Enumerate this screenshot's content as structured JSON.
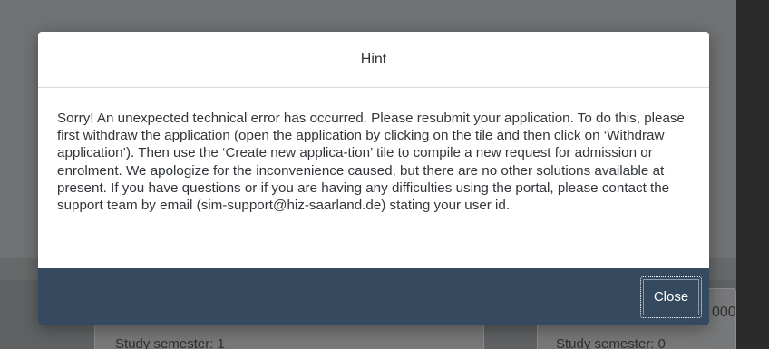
{
  "dialog": {
    "title": "Hint",
    "message": "Sorry! An unexpected technical error has occurred. Please resubmit your application. To do this, please first withdraw the application (open the application by clicking on the tile and then click on ‘Withdraw application’). Then use the ‘Create new applica-tion’ tile to compile a new request for admission or enrolment. We apologize for the inconvenience caused, but there are no other solutions available at present. If you have questions or if you are having any difficulties using the portal, please contact the support team by email (sim-support@hiz-saarland.de) stating your user id.",
    "close_label": "Close"
  },
  "background": {
    "tile_left_text": "Study semester: 1",
    "tile_right_text": "Study semester: 0",
    "partial_number": "000"
  },
  "colors": {
    "overlay": "#6f7173",
    "footer": "#354a5f",
    "dialog_bg": "#ffffff",
    "text": "#32363a"
  }
}
